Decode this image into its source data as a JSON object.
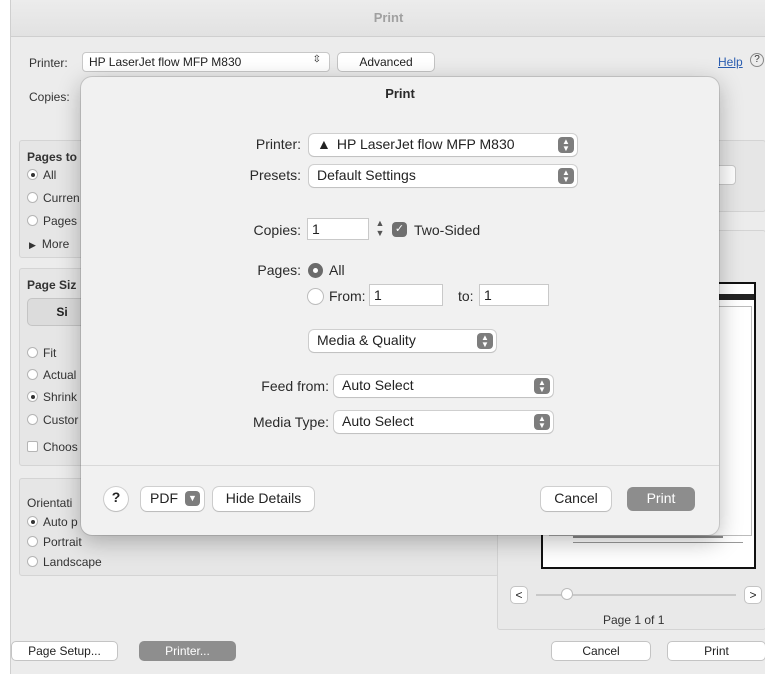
{
  "background_dialog": {
    "title": "Print",
    "printer_label": "Printer:",
    "printer_value": "HP LaserJet flow MFP M830",
    "advanced_button": "Advanced",
    "help_link": "Help",
    "copies_label": "Copies:",
    "pages_to_print_label": "Pages to",
    "pages_options": [
      "All",
      "Curren",
      "Pages",
      "More"
    ],
    "page_sizing_label": "Page Siz",
    "size_button": "Si",
    "sizing_options": [
      "Fit",
      "Actual",
      "Shrink",
      "Custor"
    ],
    "choose_checkbox": "Choos",
    "orientation_label": "Orientati",
    "orientation_options": [
      "Auto p",
      "Portrait",
      "Landscape"
    ],
    "page_indicator": "Page 1 of 1",
    "prev_button": "<",
    "next_button": ">",
    "page_setup_button": "Page Setup...",
    "printer_button": "Printer...",
    "cancel_button": "Cancel",
    "print_button": "Print"
  },
  "sheet": {
    "title": "Print",
    "printer_label": "Printer:",
    "printer_value": "HP LaserJet flow MFP M830",
    "presets_label": "Presets:",
    "presets_value": "Default Settings",
    "copies_label": "Copies:",
    "copies_value": "1",
    "two_sided_label": "Two-Sided",
    "pages_label": "Pages:",
    "pages_all_label": "All",
    "pages_from_label": "From:",
    "pages_from_value": "1",
    "pages_to_label": "to:",
    "pages_to_value": "1",
    "section_value": "Media & Quality",
    "feed_from_label": "Feed from:",
    "feed_from_value": "Auto Select",
    "media_type_label": "Media Type:",
    "media_type_value": "Auto Select",
    "help_button": "?",
    "pdf_button": "PDF",
    "hide_details_button": "Hide Details",
    "cancel_button": "Cancel",
    "print_button": "Print"
  },
  "colors": {
    "sheet_bg": "#f1f1f1",
    "dialog_bg": "#ececec",
    "primary_button": "#8d8d8d"
  }
}
